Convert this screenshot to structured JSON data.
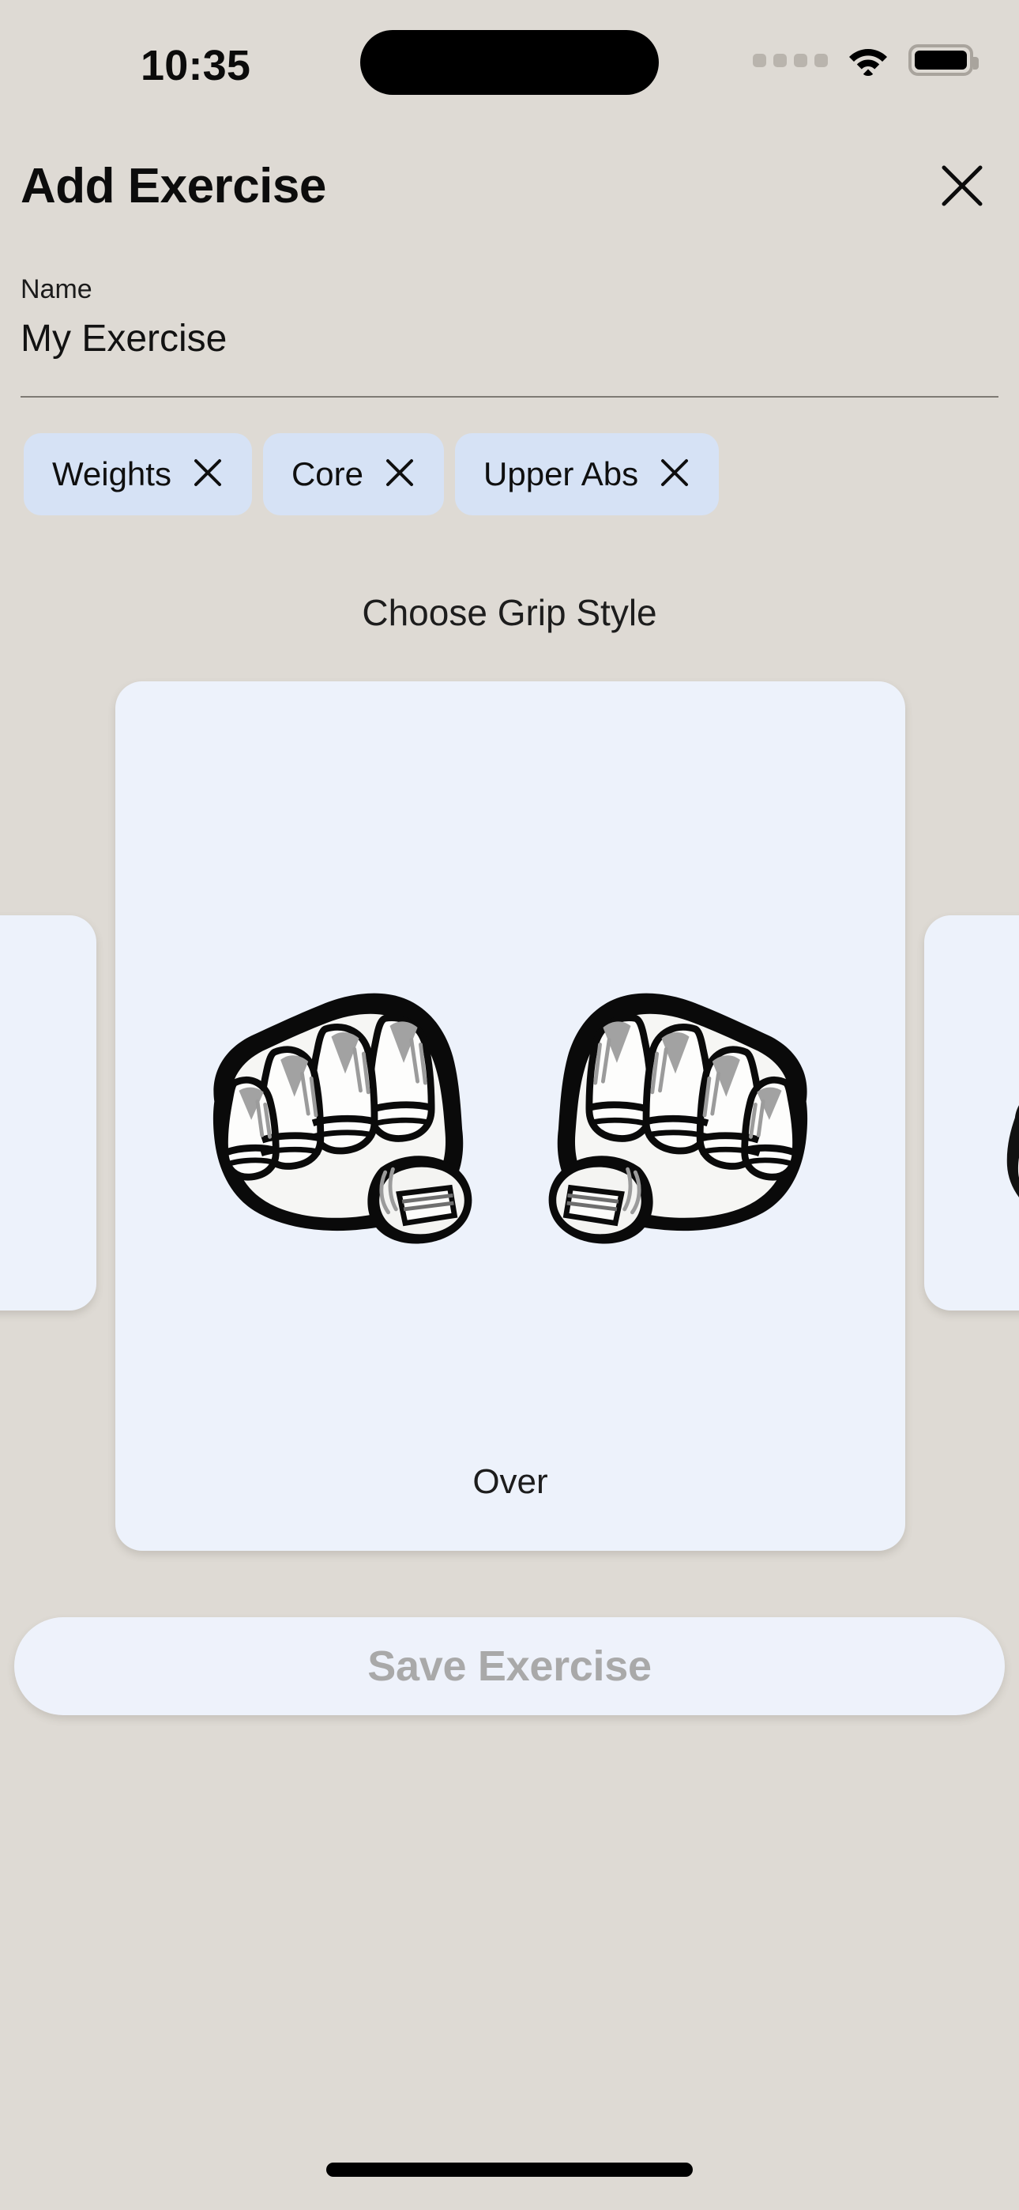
{
  "status_bar": {
    "time": "10:35",
    "cellular_icon": "cellular-dots-icon",
    "wifi_icon": "wifi-icon",
    "battery_icon": "battery-full-icon"
  },
  "header": {
    "title": "Add Exercise",
    "close_icon": "close-icon"
  },
  "name_field": {
    "label": "Name",
    "value": "My Exercise",
    "placeholder": "My Exercise"
  },
  "tags": [
    {
      "label": "Weights",
      "remove_icon": "close-icon"
    },
    {
      "label": "Core",
      "remove_icon": "close-icon"
    },
    {
      "label": "Upper Abs",
      "remove_icon": "close-icon"
    }
  ],
  "grip_section": {
    "title": "Choose Grip Style",
    "selected_card": {
      "caption": "Over",
      "illustration": "fists-knuckles-icon"
    },
    "peek_left": {
      "caption": "",
      "illustration": ""
    },
    "peek_right": {
      "caption": "",
      "illustration": "fist-under-icon"
    }
  },
  "footer": {
    "save_label": "Save Exercise",
    "save_disabled": "true"
  },
  "colors": {
    "background": "#dedad4",
    "card": "#edf2fb",
    "chip": "#d6e2f5",
    "text": "#0c0c0c",
    "disabled_text": "#a9a9a9",
    "rule": "#7e7a74"
  }
}
